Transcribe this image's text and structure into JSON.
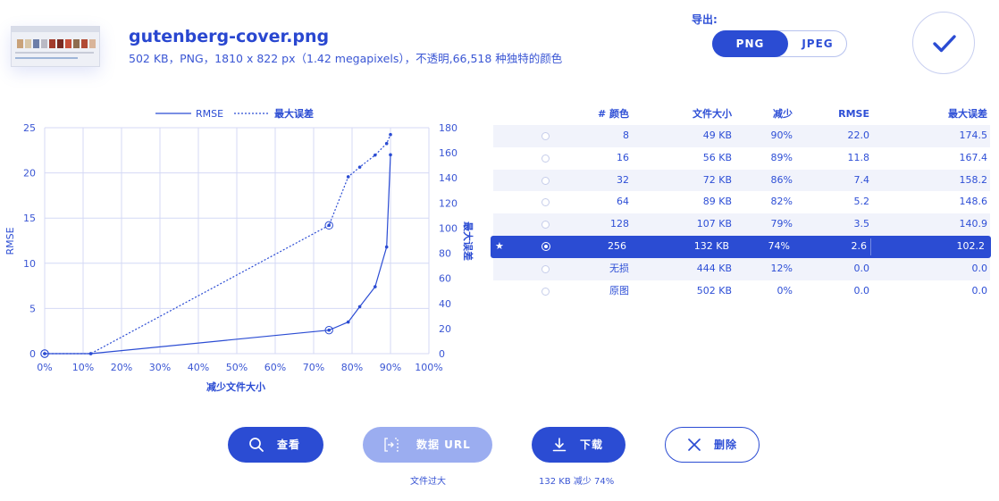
{
  "file": {
    "name": "gutenberg-cover.png",
    "details": "502 KB，PNG，1810 x 822 px（1.42 megapixels），不透明,66,518 种独特的颜色"
  },
  "export": {
    "label": "导出:",
    "options": [
      "PNG",
      "JPEG"
    ],
    "selected": "PNG"
  },
  "chart_data": {
    "type": "line",
    "xlabel": "减少文件大小",
    "ylabel": "RMSE",
    "y2label": "最大误差",
    "xlim": [
      0,
      100
    ],
    "ylim": [
      0,
      25
    ],
    "y2lim": [
      0,
      180
    ],
    "xticks": [
      "0%",
      "10%",
      "20%",
      "30%",
      "40%",
      "50%",
      "60%",
      "70%",
      "80%",
      "90%",
      "100%"
    ],
    "yticks": [
      "0",
      "5",
      "10",
      "15",
      "20",
      "25"
    ],
    "y2ticks": [
      "0",
      "20",
      "40",
      "60",
      "80",
      "100",
      "120",
      "140",
      "160",
      "180"
    ],
    "legend_position": "top",
    "grid": true,
    "series": [
      {
        "name": "RMSE",
        "style": "solid",
        "axis": "left",
        "points": [
          [
            0,
            0.0
          ],
          [
            12,
            0.0
          ],
          [
            74,
            2.6
          ],
          [
            79,
            3.5
          ],
          [
            82,
            5.2
          ],
          [
            86,
            7.4
          ],
          [
            89,
            11.8
          ],
          [
            90,
            22.0
          ]
        ]
      },
      {
        "name": "最大误差",
        "style": "dotted",
        "axis": "right",
        "points": [
          [
            0,
            0.0
          ],
          [
            12,
            0.0
          ],
          [
            74,
            102.2
          ],
          [
            79,
            140.9
          ],
          [
            82,
            148.6
          ],
          [
            86,
            158.2
          ],
          [
            89,
            167.4
          ],
          [
            90,
            174.5
          ]
        ]
      }
    ],
    "highlight_x": [
      0,
      74
    ]
  },
  "table": {
    "headers": [
      "# 颜色",
      "文件大小",
      "减少",
      "RMSE",
      "最大误差"
    ],
    "rows": [
      {
        "colors": "8",
        "size": "49 KB",
        "reduction": "90%",
        "rmse": "22.0",
        "max": "174.5"
      },
      {
        "colors": "16",
        "size": "56 KB",
        "reduction": "89%",
        "rmse": "11.8",
        "max": "167.4"
      },
      {
        "colors": "32",
        "size": "72 KB",
        "reduction": "86%",
        "rmse": "7.4",
        "max": "158.2"
      },
      {
        "colors": "64",
        "size": "89 KB",
        "reduction": "82%",
        "rmse": "5.2",
        "max": "148.6"
      },
      {
        "colors": "128",
        "size": "107 KB",
        "reduction": "79%",
        "rmse": "3.5",
        "max": "140.9"
      },
      {
        "colors": "256",
        "size": "132 KB",
        "reduction": "74%",
        "rmse": "2.6",
        "max": "102.2"
      },
      {
        "colors": "无损",
        "size": "444 KB",
        "reduction": "12%",
        "rmse": "0.0",
        "max": "0.0"
      },
      {
        "colors": "原图",
        "size": "502 KB",
        "reduction": "0%",
        "rmse": "0.0",
        "max": "0.0"
      }
    ],
    "selected_index": 5
  },
  "actions": {
    "view": "查看",
    "data_url": "数据 URL",
    "data_url_note": "文件过大",
    "download": "下载",
    "download_note": "132 KB   减少 74%",
    "delete": "删除"
  },
  "colors": {
    "accent": "#2b4cd3",
    "accent_disabled": "#9badf0",
    "grid": "#d4d9f5",
    "row_alt": "#f1f3fb"
  }
}
